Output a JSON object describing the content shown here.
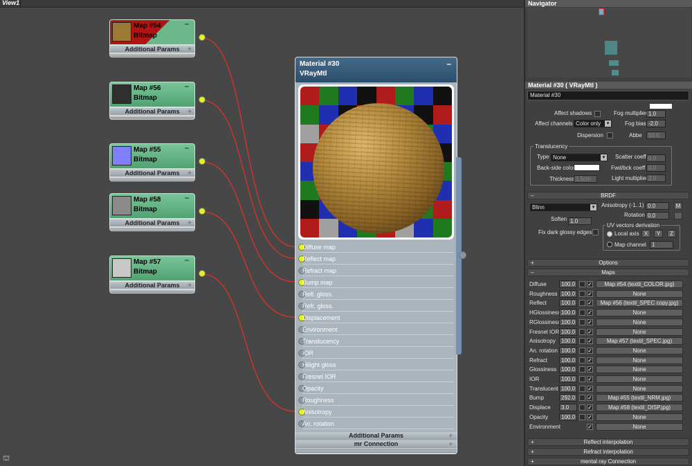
{
  "viewport": {
    "title": "View1"
  },
  "map_nodes": [
    {
      "title": "Map #54",
      "type": "Bitmap",
      "params": "Additional Params",
      "thumb": "#9a7a35"
    },
    {
      "title": "Map #56",
      "type": "Bitmap",
      "params": "Additional Params",
      "thumb": "#2f2f2f"
    },
    {
      "title": "Map #55",
      "type": "Bitmap",
      "params": "Additional Params",
      "thumb": "#8080ff"
    },
    {
      "title": "Map #58",
      "type": "Bitmap",
      "params": "Additional Params",
      "thumb": "#8a8a8a"
    },
    {
      "title": "Map #57",
      "type": "Bitmap",
      "params": "Additional Params",
      "thumb": "#c8c8c8"
    }
  ],
  "material_node": {
    "title": "Material #30",
    "type": "VRayMtl",
    "slots": [
      {
        "label": "Diffuse map",
        "connected": true
      },
      {
        "label": "Reflect map",
        "connected": true
      },
      {
        "label": "Refract map",
        "connected": false
      },
      {
        "label": "Bump map",
        "connected": true
      },
      {
        "label": "Refl. gloss.",
        "connected": false
      },
      {
        "label": "Refr. gloss.",
        "connected": false
      },
      {
        "label": "Displacement",
        "connected": true
      },
      {
        "label": "Environment",
        "connected": false
      },
      {
        "label": "Translucency",
        "connected": false
      },
      {
        "label": "IOR",
        "connected": false
      },
      {
        "label": "Hilight gloss",
        "connected": false
      },
      {
        "label": "Fresnel IOR",
        "connected": false
      },
      {
        "label": "Opacity",
        "connected": false
      },
      {
        "label": "Roughness",
        "connected": false
      },
      {
        "label": "Anisotropy",
        "connected": true
      },
      {
        "label": "An. rotation",
        "connected": false
      }
    ],
    "additional_params": "Additional Params",
    "mr_connection": "mr Connection"
  },
  "navigator": {
    "title": "Navigator"
  },
  "params_panel": {
    "title": "Material #30  ( VRayMtl )",
    "name_field": "Material #30",
    "fog": {
      "affect_shadows": "Affect shadows",
      "affect_channels": "Affect channels",
      "affect_channels_value": "Color only",
      "dispersion": "Dispersion",
      "fog_multiplier": "Fog multiplier",
      "fog_multiplier_value": "1.0",
      "fog_bias": "Fog bias",
      "fog_bias_value": "-2.0",
      "abbe": "Abbe",
      "abbe_value": "50.0"
    },
    "translucency": {
      "group": "Translucency",
      "type_label": "Type",
      "type_value": "None",
      "backside": "Back-side color",
      "thickness": "Thickness",
      "thickness_value": "1.5cm",
      "scatter": "Scatter coeff",
      "scatter_value": "0.0",
      "fwd_bck": "Fwd/bck coeff",
      "fwd_bck_value": "0.0",
      "light_mult": "Light multiplier",
      "light_mult_value": "2.0"
    },
    "brdf": {
      "header": "BRDF",
      "type_value": "Blinn",
      "anisotropy": "Anisotropy (-1..1)",
      "anisotropy_value": "0.0",
      "m_button": "M",
      "rotation": "Rotation",
      "rotation_value": "0.0",
      "soften": "Soften",
      "soften_value": "1.0",
      "fix_dark": "Fix dark glossy edges",
      "uv_group": "UV vectors derivation",
      "local_axis": "Local axis",
      "x": "X",
      "y": "Y",
      "z": "Z",
      "map_channel": "Map channel",
      "map_channel_value": "1"
    },
    "options": "Options",
    "maps_header": "Maps",
    "maps": [
      {
        "name": "Diffuse",
        "amount": "100.0",
        "map": "Map #54 (textil_COLOR.jpg)"
      },
      {
        "name": "Roughness",
        "amount": "100.0",
        "map": "None"
      },
      {
        "name": "Reflect",
        "amount": "100.0",
        "map": "Map #56 (textil_SPEC copy.jpg)"
      },
      {
        "name": "HGlossiness",
        "amount": "100.0",
        "map": "None"
      },
      {
        "name": "RGlossiness",
        "amount": "100.0",
        "map": "None"
      },
      {
        "name": "Fresnel IOR",
        "amount": "100.0",
        "map": "None"
      },
      {
        "name": "Anisotropy",
        "amount": "100.0",
        "map": "Map #57 (textil_SPEC.jpg)"
      },
      {
        "name": "An. rotation",
        "amount": "100.0",
        "map": "None"
      },
      {
        "name": "Refract",
        "amount": "100.0",
        "map": "None"
      },
      {
        "name": "Glossiness",
        "amount": "100.0",
        "map": "None"
      },
      {
        "name": "IOR",
        "amount": "100.0",
        "map": "None"
      },
      {
        "name": "Translucent",
        "amount": "100.0",
        "map": "None"
      },
      {
        "name": "Bump",
        "amount": "292.0",
        "map": "Map #55 (textil_NRM.jpg)"
      },
      {
        "name": "Displace",
        "amount": "3.0",
        "map": "Map #58 (textil_DISP.jpg)"
      },
      {
        "name": "Opacity",
        "amount": "100.0",
        "map": "None"
      },
      {
        "name": "Environment",
        "amount": "",
        "map": "None"
      }
    ],
    "rollouts": [
      "Reflect interpolation",
      "Refract interpolation",
      "mental ray Connection"
    ]
  },
  "colors": {
    "wire": "#e0302a",
    "node_green": "#5fae80",
    "socket_on": "#e2f220"
  }
}
